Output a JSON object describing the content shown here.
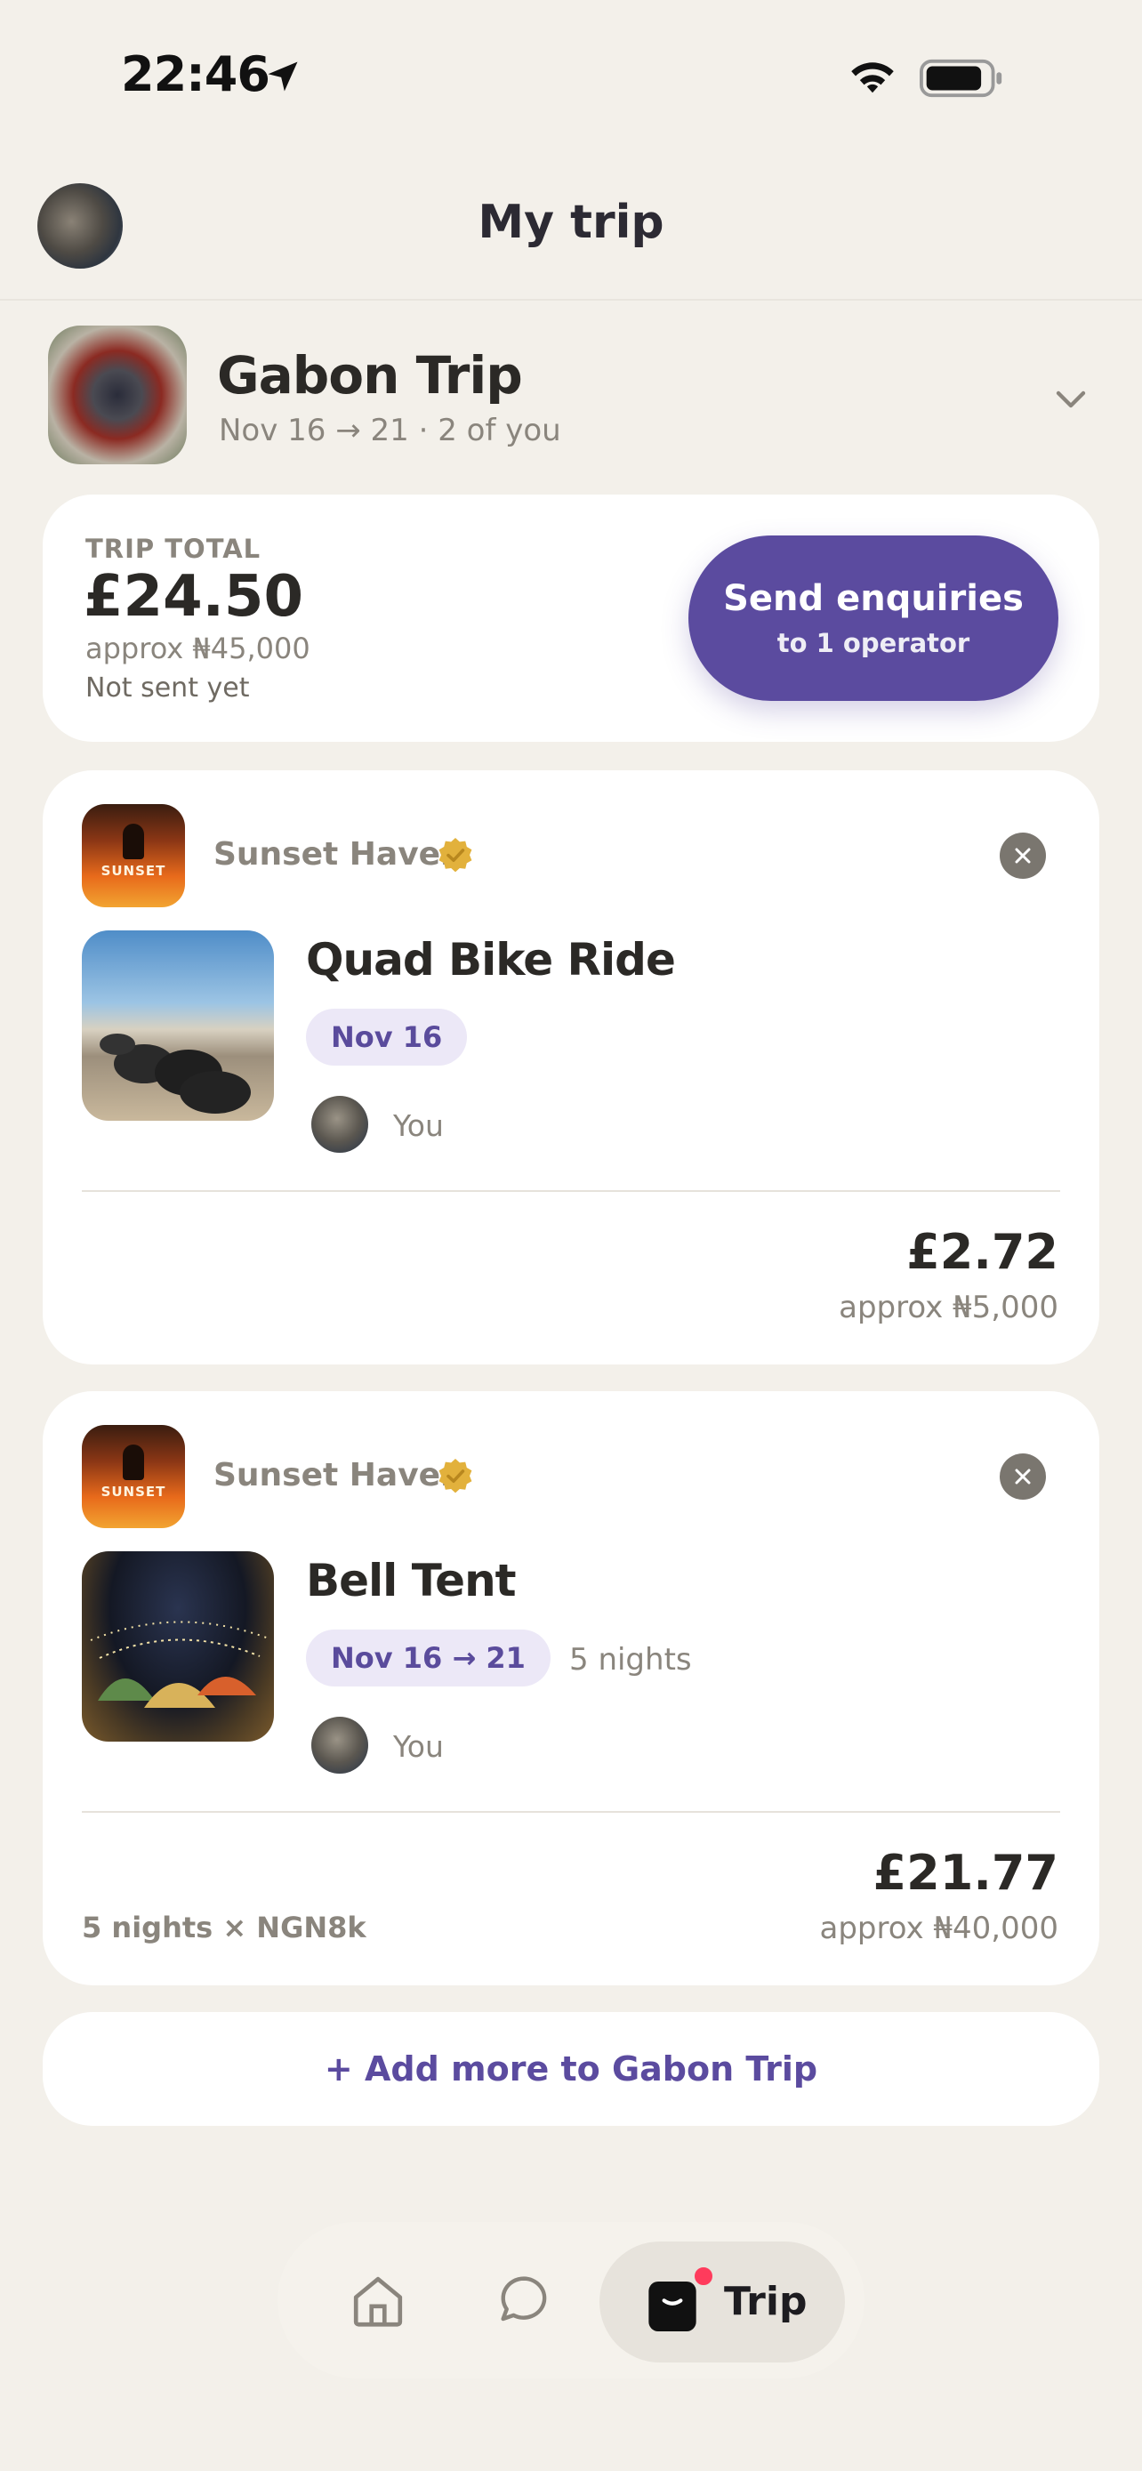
{
  "status_bar": {
    "time": "22:46"
  },
  "header": {
    "title": "My trip"
  },
  "trip": {
    "name": "Gabon Trip",
    "meta": "Nov 16 → 21 · 2 of you"
  },
  "total": {
    "label": "TRIP TOTAL",
    "amount": "£24.50",
    "approx": "approx ₦45,000",
    "status": "Not sent yet",
    "button_title": "Send enquiries",
    "button_sub": "to 1 operator"
  },
  "items": [
    {
      "operator": "Sunset Haven",
      "logo_text": "SUNSET",
      "title": "Quad Bike Ride",
      "date": "Nov 16",
      "nights": "",
      "person": "You",
      "price": "£2.72",
      "approx": "approx ₦5,000",
      "breakdown": ""
    },
    {
      "operator": "Sunset Haven",
      "logo_text": "SUNSET",
      "title": "Bell Tent",
      "date": "Nov 16 → 21",
      "nights": "5 nights",
      "person": "You",
      "price": "£21.77",
      "approx": "approx ₦40,000",
      "breakdown": "5 nights × NGN8k"
    }
  ],
  "add_more": {
    "label": "+ Add more to Gabon Trip"
  },
  "tabbar": {
    "active_label": "Trip",
    "icons": [
      "home-icon",
      "chat-icon",
      "trip-bag-icon"
    ],
    "badge_color": "#ff3b5c"
  },
  "colors": {
    "accent": "#5b4b9f",
    "background": "#f3f0ea",
    "verified": "#e2b13c"
  }
}
